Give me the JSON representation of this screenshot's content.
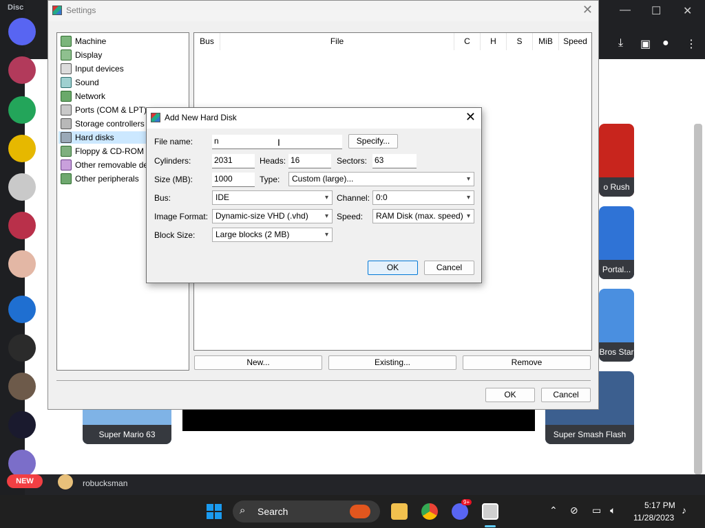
{
  "discord": {
    "app_name": "Disc",
    "new_badge": "NEW",
    "username": "robucksman",
    "games": [
      "Super Mario 63",
      "Super Smash Flash",
      "Bros Star",
      "Portal...",
      "o Rush"
    ]
  },
  "settings": {
    "title": "Settings",
    "categories": [
      {
        "label": "Machine"
      },
      {
        "label": "Display"
      },
      {
        "label": "Input devices"
      },
      {
        "label": "Sound"
      },
      {
        "label": "Network"
      },
      {
        "label": "Ports (COM & LPT)"
      },
      {
        "label": "Storage controllers"
      },
      {
        "label": "Hard disks",
        "selected": true
      },
      {
        "label": "Floppy & CD-ROM d"
      },
      {
        "label": "Other removable de"
      },
      {
        "label": "Other peripherals"
      }
    ],
    "table_headers": {
      "bus": "Bus",
      "file": "File",
      "c": "C",
      "h": "H",
      "s": "S",
      "mib": "MiB",
      "speed": "Speed"
    },
    "buttons": {
      "new": "New...",
      "existing": "Existing...",
      "remove": "Remove",
      "ok": "OK",
      "cancel": "Cancel"
    }
  },
  "dialog": {
    "title": "Add New Hard Disk",
    "file_name_label": "File name:",
    "file_name_value": "n",
    "specify": "Specify...",
    "cylinders_label": "Cylinders:",
    "cylinders_value": "2031",
    "heads_label": "Heads:",
    "heads_value": "16",
    "sectors_label": "Sectors:",
    "sectors_value": "63",
    "size_label": "Size (MB):",
    "size_value": "1000",
    "type_label": "Type:",
    "type_value": "Custom (large)...",
    "bus_label": "Bus:",
    "bus_value": "IDE",
    "channel_label": "Channel:",
    "channel_value": "0:0",
    "image_format_label": "Image Format:",
    "image_format_value": "Dynamic-size VHD (.vhd)",
    "speed_label": "Speed:",
    "speed_value": "RAM Disk (max. speed)",
    "block_size_label": "Block Size:",
    "block_size_value": "Large blocks (2 MB)",
    "ok": "OK",
    "cancel": "Cancel"
  },
  "taskbar": {
    "search": "Search",
    "time": "5:17 PM",
    "date": "11/28/2023",
    "discord_badge": "9+"
  }
}
